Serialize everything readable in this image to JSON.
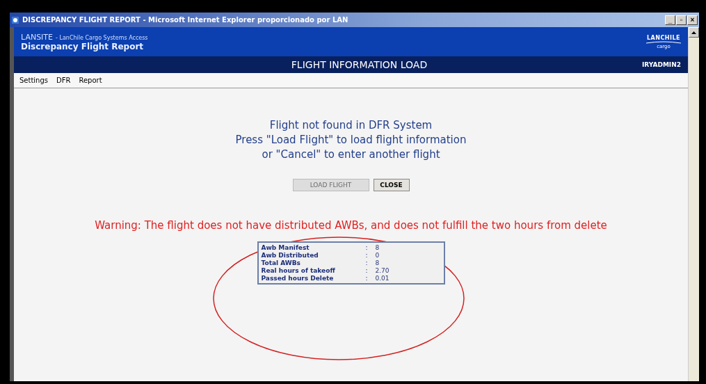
{
  "window": {
    "title": "DISCREPANCY FLIGHT REPORT - Microsoft Internet Explorer proporcionado por LAN",
    "controls": [
      "_",
      "▫",
      "×"
    ]
  },
  "header": {
    "site": "LANSITE",
    "subtitle": "- LanChile Cargo Systems Access",
    "app_title": "Discrepancy Flight Report",
    "logo_text": "LANCHILE",
    "logo_sub": "cargo"
  },
  "page_bar": {
    "title": "FLIGHT INFORMATION LOAD",
    "user": "IRYADMIN2"
  },
  "menu": [
    "Settings",
    "DFR",
    "Report"
  ],
  "message": [
    "Flight not found in DFR System",
    "Press \"Load Flight\" to load flight information",
    "or \"Cancel\" to enter another flight"
  ],
  "buttons": [
    {
      "label": "LOAD FLIGHT",
      "disabled": true
    },
    {
      "label": "CLOSE",
      "disabled": false
    }
  ],
  "warning": "Warning: The flight does not have distributed AWBs, and does not fulfill the two hours from delete",
  "summary": [
    {
      "label": "Awb Manifest",
      "separator": ":",
      "value": "8"
    },
    {
      "label": "Awb Distributed",
      "separator": ":",
      "value": "0"
    },
    {
      "label": "Total AWBs",
      "separator": ":",
      "value": "8"
    },
    {
      "label": "Real hours of takeoff",
      "separator": ":",
      "value": "2.70"
    },
    {
      "label": "Passed hours Delete",
      "separator": ":",
      "value": "0.01"
    }
  ],
  "annotation": {
    "kind": "ellipse",
    "color": "#d42020"
  }
}
